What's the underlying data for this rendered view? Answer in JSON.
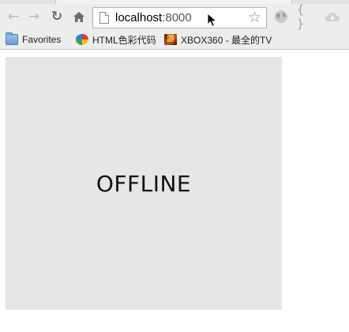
{
  "toolbar": {
    "back_icon": "back-arrow-icon",
    "forward_icon": "forward-arrow-icon",
    "reload_icon": "reload-icon",
    "home_icon": "home-icon",
    "url_host": "localhost",
    "url_port": ":8000",
    "bookmark_star_icon": "star-icon",
    "extensions": [
      "globe-icon",
      "json-braces-icon",
      "cloud-icon"
    ]
  },
  "bookmarks": [
    {
      "label": "Favorites",
      "icon": "folder-icon"
    },
    {
      "label": "HTML色彩代码",
      "icon": "color-wheel-icon"
    },
    {
      "label": "XBOX360 - 最全的TV",
      "icon": "game-site-icon"
    }
  ],
  "page": {
    "status_text": "OFFLINE",
    "panel_color": "#e6e6e5"
  }
}
